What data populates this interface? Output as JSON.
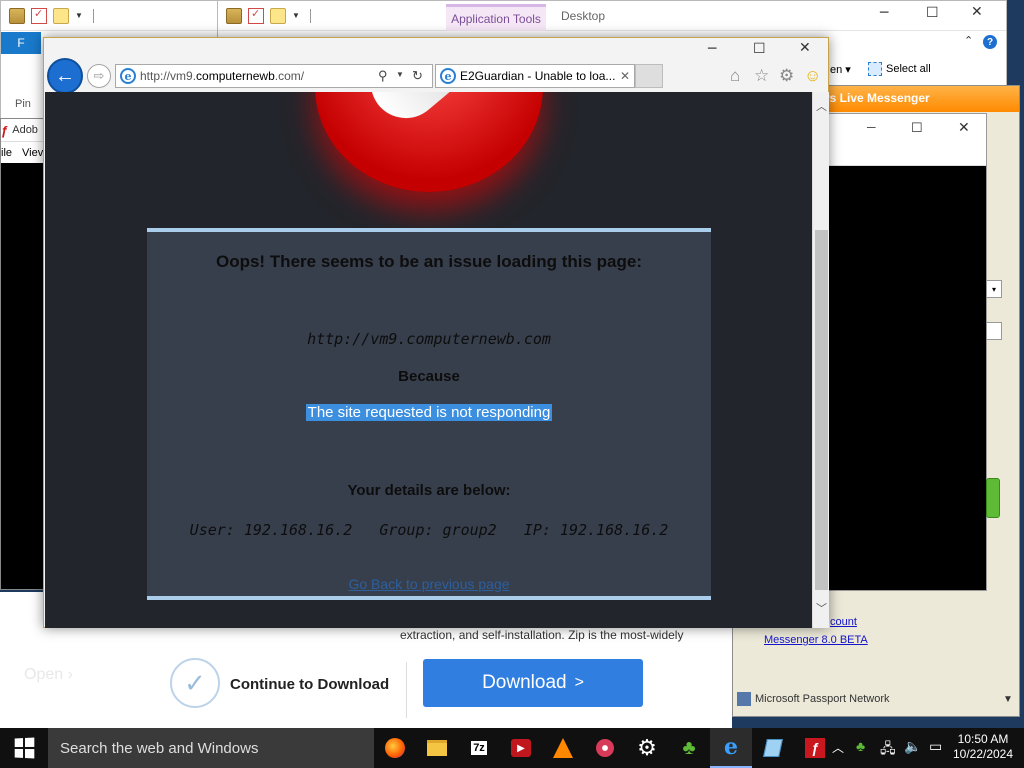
{
  "explorer_back": {
    "file_tab": "F",
    "pin_label": "Pin"
  },
  "explorer_front": {
    "app_tools_label": "Application Tools",
    "desktop_label": "Desktop",
    "select_all_label": "Select all",
    "open_partial": "en",
    "help_glyph": "?"
  },
  "adobe": {
    "title_partial": "Adob",
    "menu_file_partial": "ile",
    "menu_view_partial": "Viev"
  },
  "messenger": {
    "title_partial": "ows Live Messenger",
    "link_account": "count",
    "link_beta": "Messenger 8.0 BETA",
    "footer": "Microsoft Passport Network"
  },
  "web_page": {
    "body_text": "extraction, and self-installation. Zip is the most-widely",
    "open_partial": "Open",
    "continue_label": "Continue to Download",
    "download_label": "Download",
    "download_arrow": ">"
  },
  "ie": {
    "back_arrow": "←",
    "forward_arrow": "⇨",
    "address_prefix": "http://vm9.",
    "address_domain": "computernewb",
    "address_suffix": ".com/",
    "tab_title": "E2Guardian - Unable to loa...",
    "tab_close": "✕"
  },
  "error_page": {
    "heading": "Oops! There seems to be an issue loading this page:",
    "url": "http://vm9.computernewb.com",
    "because": "Because",
    "reason": "The site requested is not responding",
    "details_heading": "Your details are below:",
    "details": "User: 192.168.16.2   Group: group2   IP: 192.168.16.2",
    "go_back": "Go Back to previous page"
  },
  "taskbar": {
    "search_placeholder": "Search the web and Windows",
    "time": "10:50 AM",
    "date": "10/22/2024",
    "sevenzip_label": "7z"
  },
  "colors": {
    "ie_blue": "#1c6fd0",
    "error_box": "#383f4c",
    "highlight": "#3c8ede",
    "download_button": "#2f7ee0",
    "taskbar": "#101010"
  }
}
